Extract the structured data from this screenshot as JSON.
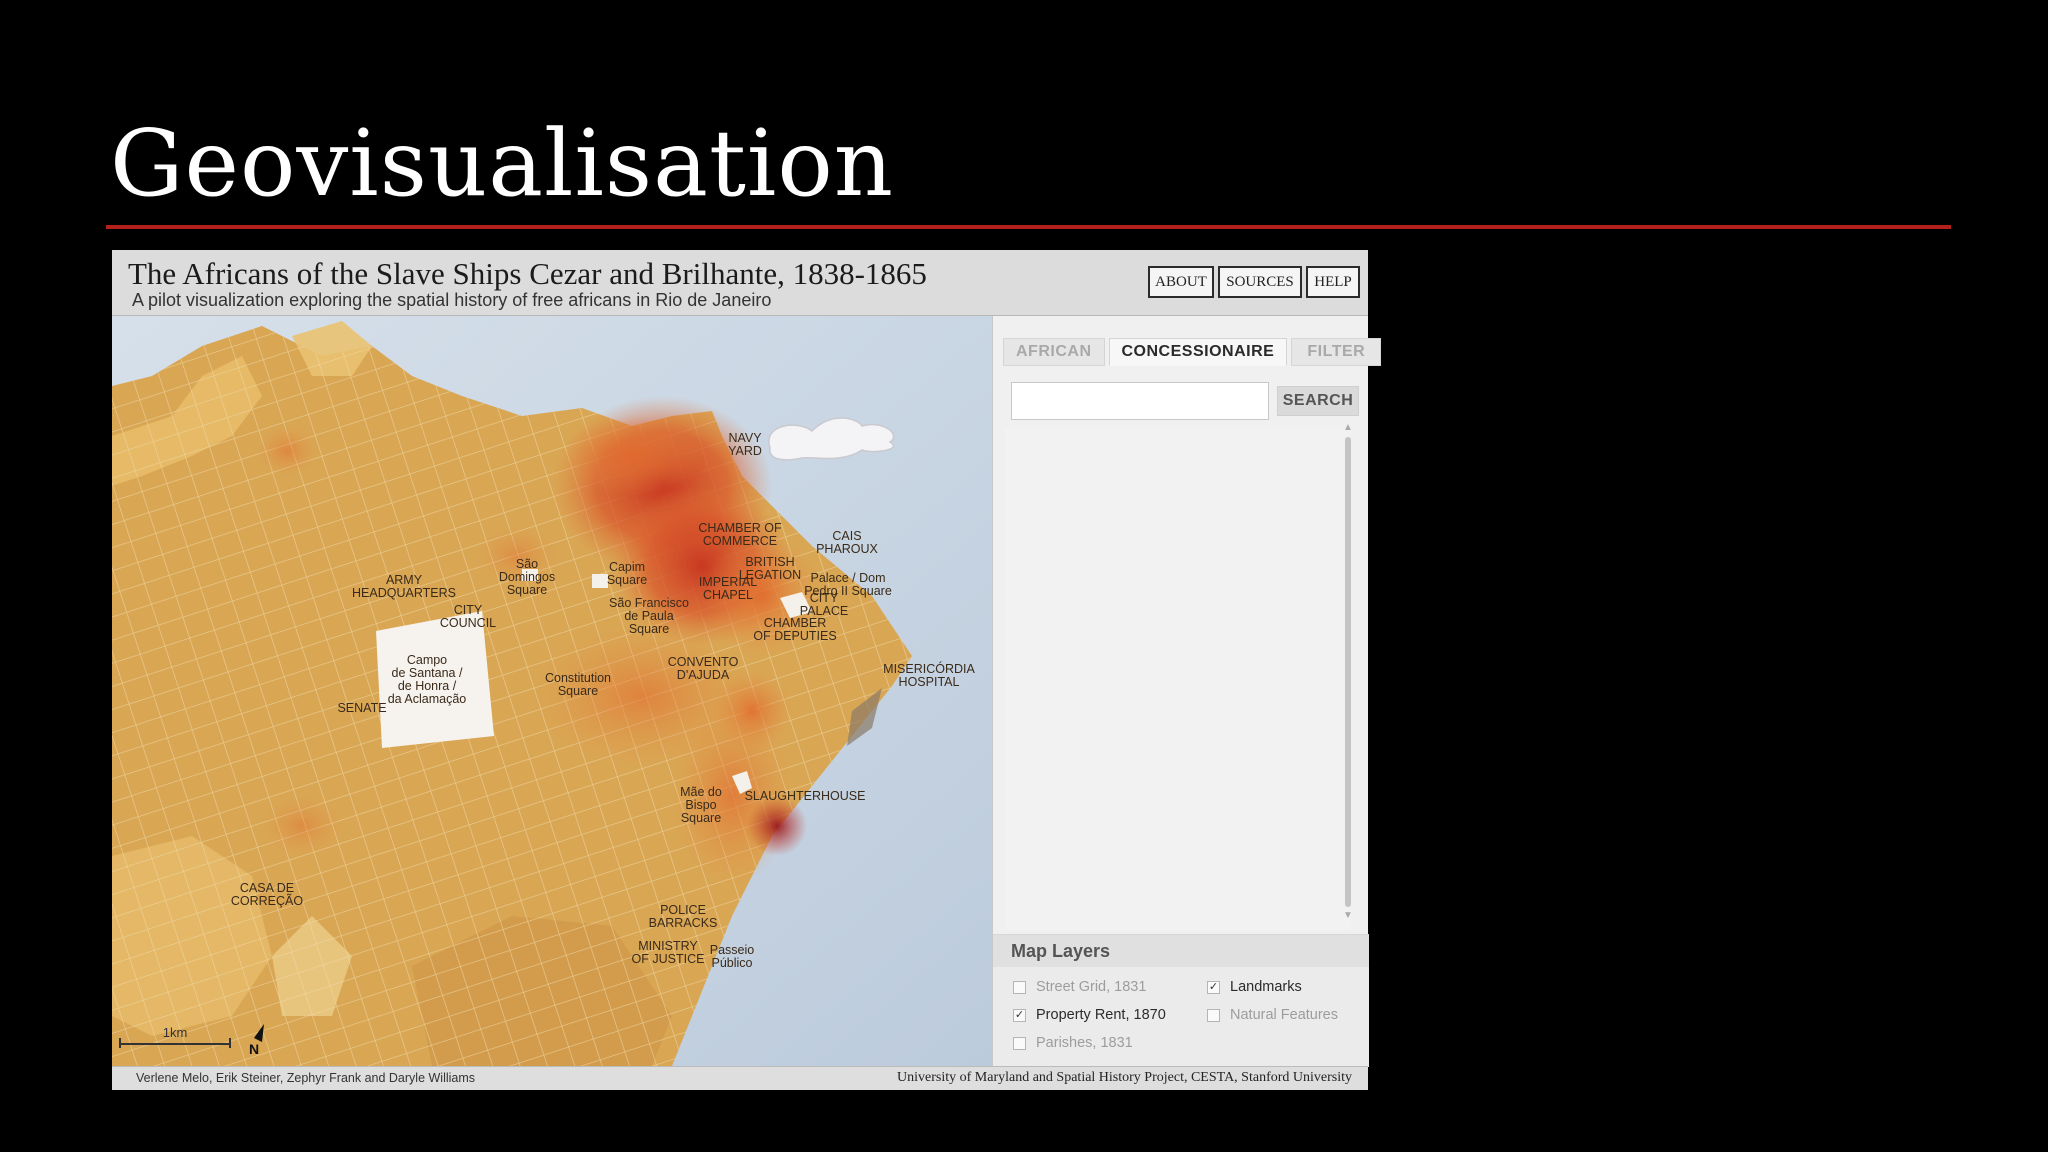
{
  "slide": {
    "title": "Geovisualisation"
  },
  "app": {
    "title": "The Africans of the Slave Ships Cezar and Brilhante, 1838-1865",
    "subtitle": "A pilot visualization exploring the spatial history of free africans in Rio de Janeiro",
    "buttons": [
      "ABOUT",
      "SOURCES",
      "HELP"
    ]
  },
  "map": {
    "scale_label": "1km",
    "north_label": "N",
    "labels": [
      [
        "NAVY",
        "YARD"
      ],
      [
        "CHAMBER OF",
        "COMMERCE"
      ],
      [
        "CAIS",
        "PHAROUX"
      ],
      [
        "BRITISH",
        "LEGATION"
      ],
      [
        "Palace / Dom",
        "Pedro II Square"
      ],
      [
        "IMPERIAL",
        "CHAPEL"
      ],
      [
        "CITY",
        "PALACE"
      ],
      [
        "Capim",
        "Square"
      ],
      [
        "São",
        "Domingos",
        "Square"
      ],
      [
        "ARMY",
        "HEADQUARTERS"
      ],
      [
        "São Francisco",
        "de Paula",
        "Square"
      ],
      [
        "CITY",
        "COUNCIL"
      ],
      [
        "CHAMBER",
        "OF DEPUTIES"
      ],
      [
        "Campo",
        "de Santana /",
        "de Honra /",
        "da Aclamação"
      ],
      [
        "CONVENTO",
        "D'AJUDA"
      ],
      [
        "MISERICÓRDIA",
        "HOSPITAL"
      ],
      [
        "Constitution",
        "Square"
      ],
      [
        "SENATE"
      ],
      [
        "Mãe do",
        "Bispo",
        "Square"
      ],
      [
        "SLAUGHTERHOUSE"
      ],
      [
        "CASA DE",
        "CORREÇÃO"
      ],
      [
        "POLICE",
        "BARRACKS"
      ],
      [
        "MINISTRY",
        "OF JUSTICE"
      ],
      [
        "Passeio",
        "Público"
      ]
    ]
  },
  "panel": {
    "tabs": [
      "AFRICAN",
      "CONCESSIONAIRE",
      "FILTER"
    ],
    "active_tab": "CONCESSIONAIRE",
    "search": {
      "value": "",
      "placeholder": "",
      "button": "SEARCH"
    },
    "layers": {
      "heading": "Map Layers",
      "items": [
        {
          "label": "Street Grid, 1831",
          "checked": false
        },
        {
          "label": "Landmarks",
          "checked": true
        },
        {
          "label": "Property Rent, 1870",
          "checked": true
        },
        {
          "label": "Natural Features",
          "checked": false
        },
        {
          "label": "Parishes, 1831",
          "checked": false
        }
      ]
    }
  },
  "footer": {
    "credits_left": "Verlene Melo, Erik Steiner, Zephyr Frank and Daryle Williams",
    "credits_right": "University of Maryland and Spatial History Project, CESTA, Stanford University"
  },
  "colors": {
    "accent_rule": "#b3201b",
    "water": "#c9d6e4",
    "land": "#d9a654",
    "heat_high": "#c8321e"
  }
}
